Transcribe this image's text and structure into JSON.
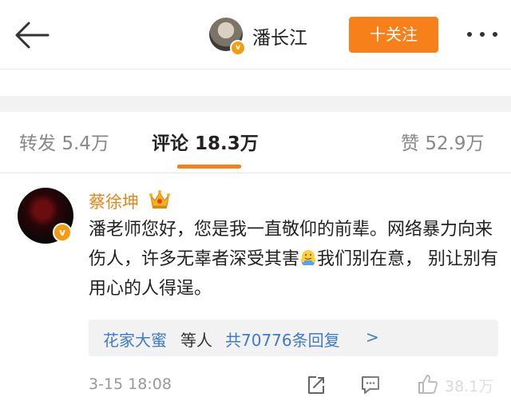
{
  "header": {
    "user_name": "潘长江",
    "follow_label": "十关注"
  },
  "tabs": [
    {
      "label": "转发",
      "count": "5.4万"
    },
    {
      "label": "评论",
      "count": "18.3万",
      "active": true
    },
    {
      "label": "赞",
      "count": "52.9万"
    }
  ],
  "comment": {
    "author": "蔡徐坤",
    "text_part1": "潘老师您好，您是我一直敬仰的前辈。网络暴力向来伤人，许多无辜者深受其害",
    "text_part2": "我们别在意， 别让别有用心的人得逞。",
    "replies_names": "花家大蜜",
    "replies_etc": "等人",
    "replies_count": "共70776条回复",
    "replies_chevron": ">",
    "time": "3-15 18:08",
    "likes": "38.1万"
  },
  "icons": {
    "back": "back-arrow-icon",
    "more": "more-dots-icon",
    "verified": "verified-v-icon",
    "crown": "crown-icon",
    "emoji": "hug-emoji-icon",
    "forward": "forward-icon",
    "reply": "reply-icon",
    "like": "thumbs-up-icon"
  },
  "colors": {
    "accent": "#f7801a",
    "link": "#3d7bcc",
    "name": "#e5851a"
  }
}
